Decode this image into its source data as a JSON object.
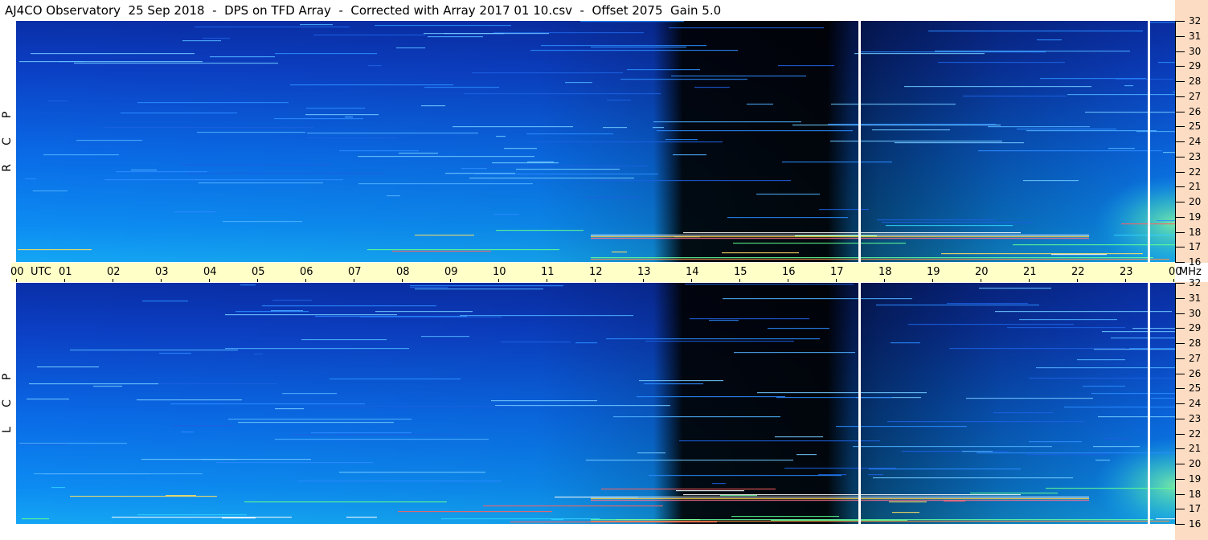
{
  "title": "AJ4CO Observatory  25 Sep 2018  -  DPS on TFD Array  -  Corrected with Array 2017 01 10.csv  -  Offset 2075  Gain 5.0",
  "colors": {
    "background_blue": "#0c42c8",
    "time_bar": "#ffffc8",
    "freq_axis": "#fcdcc2",
    "gap_line": "#ffffff"
  },
  "chart_data": [
    {
      "type": "heatmap",
      "name_label": [
        "R",
        "C",
        "P"
      ],
      "x_unit": "UTC",
      "x_ticks": [
        "00",
        "01",
        "02",
        "03",
        "04",
        "05",
        "06",
        "07",
        "08",
        "09",
        "10",
        "11",
        "12",
        "13",
        "14",
        "15",
        "16",
        "17",
        "18",
        "19",
        "20",
        "21",
        "22",
        "23",
        "00"
      ],
      "x_range_hours": [
        0,
        24
      ],
      "y_unit": "MHz",
      "y_ticks": [
        32,
        31,
        30,
        29,
        28,
        27,
        26,
        25,
        24,
        23,
        22,
        21,
        20,
        19,
        18,
        17,
        16
      ],
      "y_range": [
        16,
        32
      ],
      "data_gaps_utc": [
        17.5,
        23.5
      ]
    },
    {
      "type": "heatmap",
      "name_label": [
        "L",
        "C",
        "P"
      ],
      "x_unit": "UTC",
      "x_ticks": [
        "00",
        "01",
        "02",
        "03",
        "04",
        "05",
        "06",
        "07",
        "08",
        "09",
        "10",
        "11",
        "12",
        "13",
        "14",
        "15",
        "16",
        "17",
        "18",
        "19",
        "20",
        "21",
        "22",
        "23",
        "00"
      ],
      "x_range_hours": [
        0,
        24
      ],
      "y_unit": "MHz",
      "y_ticks": [
        32,
        31,
        30,
        29,
        28,
        27,
        26,
        25,
        24,
        23,
        22,
        21,
        20,
        19,
        18,
        17,
        16
      ],
      "y_range": [
        16,
        32
      ],
      "data_gaps_utc": [
        17.5,
        23.5
      ]
    }
  ],
  "time_axis": {
    "utc_label": "UTC",
    "mhz_label": "MHz",
    "first_tick": "00",
    "last_tick": "00"
  }
}
